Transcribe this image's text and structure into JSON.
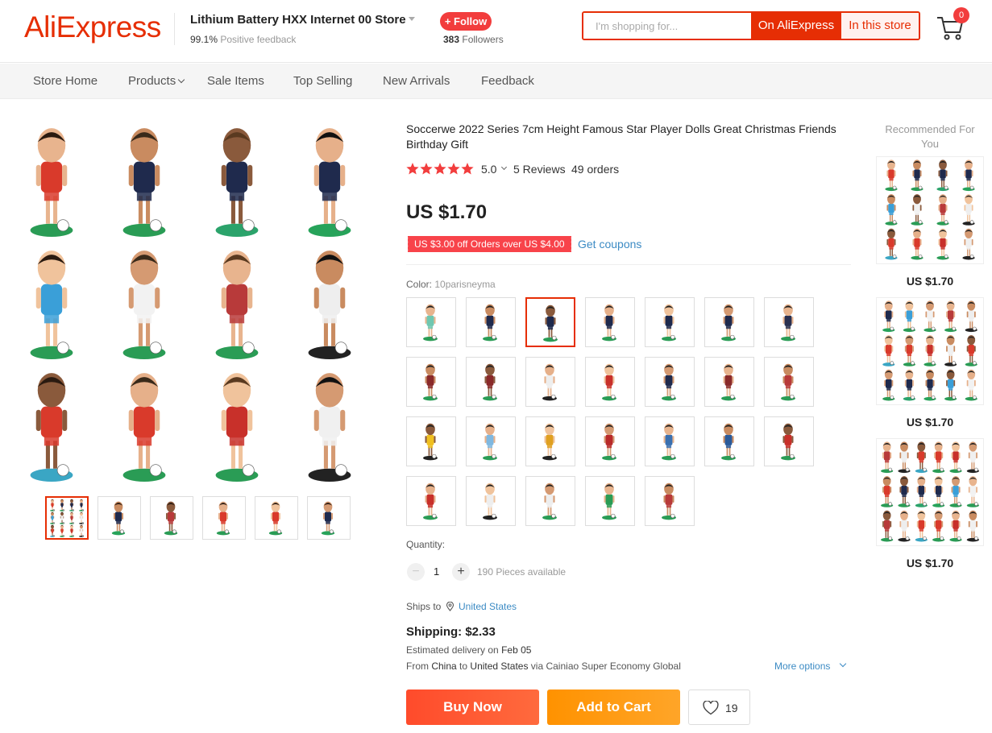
{
  "header": {
    "logo": "AliExpress",
    "store_name": "Lithium Battery HXX Internet 00 Store",
    "feedback_percent": "99.1%",
    "feedback_label": "Positive feedback",
    "follow_label": "+ Follow",
    "followers_count": "383",
    "followers_label": "Followers",
    "search_placeholder": "I'm shopping for...",
    "search_ali_label": "On AliExpress",
    "search_store_label": "In this store",
    "cart_count": "0",
    "cart_icon": "cart-icon"
  },
  "nav": {
    "items": [
      {
        "label": "Store Home"
      },
      {
        "label": "Products"
      },
      {
        "label": "Sale Items"
      },
      {
        "label": "Top Selling"
      },
      {
        "label": "New Arrivals"
      },
      {
        "label": "Feedback"
      }
    ]
  },
  "product": {
    "title": "Soccerwe 2022 Series 7cm Height Famous Star Player Dolls Great Christmas Friends Birthday Gift",
    "rating_value": "5.0",
    "reviews": "5 Reviews",
    "orders": "49 orders",
    "stars": 5,
    "price": "US $1.70",
    "coupon": "US $3.00 off Orders over US $4.00",
    "get_coupons": "Get coupons",
    "color_label": "Color:",
    "color_selected": "10parisneyma",
    "swatch_count": 26,
    "selected_swatch_index": 2,
    "quantity_label": "Quantity:",
    "quantity_value": "1",
    "quantity_available": "190 Pieces available",
    "ships_to_label": "Ships to",
    "ships_to_country": "United States",
    "shipping": "Shipping: $2.33",
    "delivery_label": "Estimated delivery on",
    "delivery_date": "Feb 05",
    "route_from_label": "From",
    "route_from": "China",
    "route_to_label": "to",
    "route_to": "United States",
    "route_via": "via Cainiao Super Economy Global",
    "more_options": "More options",
    "buy_now": "Buy Now",
    "add_to_cart": "Add to Cart",
    "wishlist_count": "19"
  },
  "gallery": {
    "thumb_count": 6,
    "active_thumb": 0
  },
  "recommended": {
    "title": "Recommended For You",
    "items": [
      {
        "price": "US $1.70"
      },
      {
        "price": "US $1.70"
      },
      {
        "price": "US $1.70"
      }
    ]
  },
  "colors": {
    "brand": "#e62e04",
    "follow": "#f23d3d",
    "coupon": "#f8434a",
    "link": "#3c8bc4",
    "buy_now": "#ff4b2b",
    "add_cart": "#ff9200",
    "star": "#f23d3d"
  }
}
